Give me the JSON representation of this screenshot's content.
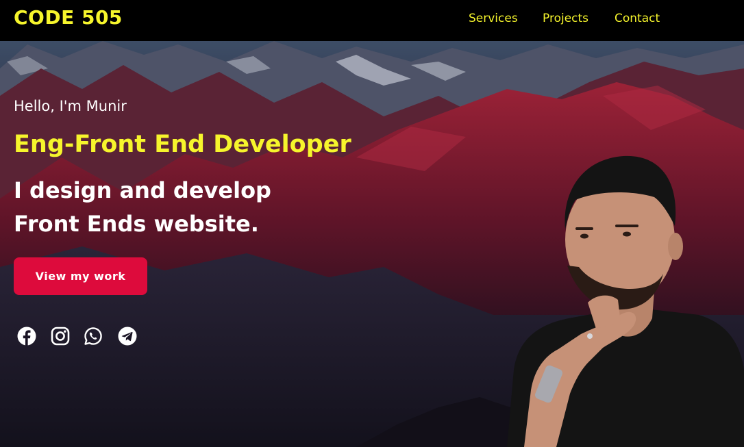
{
  "header": {
    "logo": "CODE 505",
    "nav": [
      "Services",
      "Projects",
      "Contact"
    ]
  },
  "hero": {
    "greeting": "Hello, I'm Munir",
    "role": "Eng-Front End Developer",
    "headline_line1": "I design and develop",
    "headline_line2": "Front Ends website.",
    "cta_label": "View my work"
  },
  "social_icons": [
    "facebook-icon",
    "instagram-icon",
    "whatsapp-icon",
    "telegram-icon"
  ],
  "colors": {
    "accent_yellow": "#f6f52c",
    "cta_red": "#dd0b3c",
    "navbar_bg": "#000000",
    "text_white": "#ffffff"
  }
}
